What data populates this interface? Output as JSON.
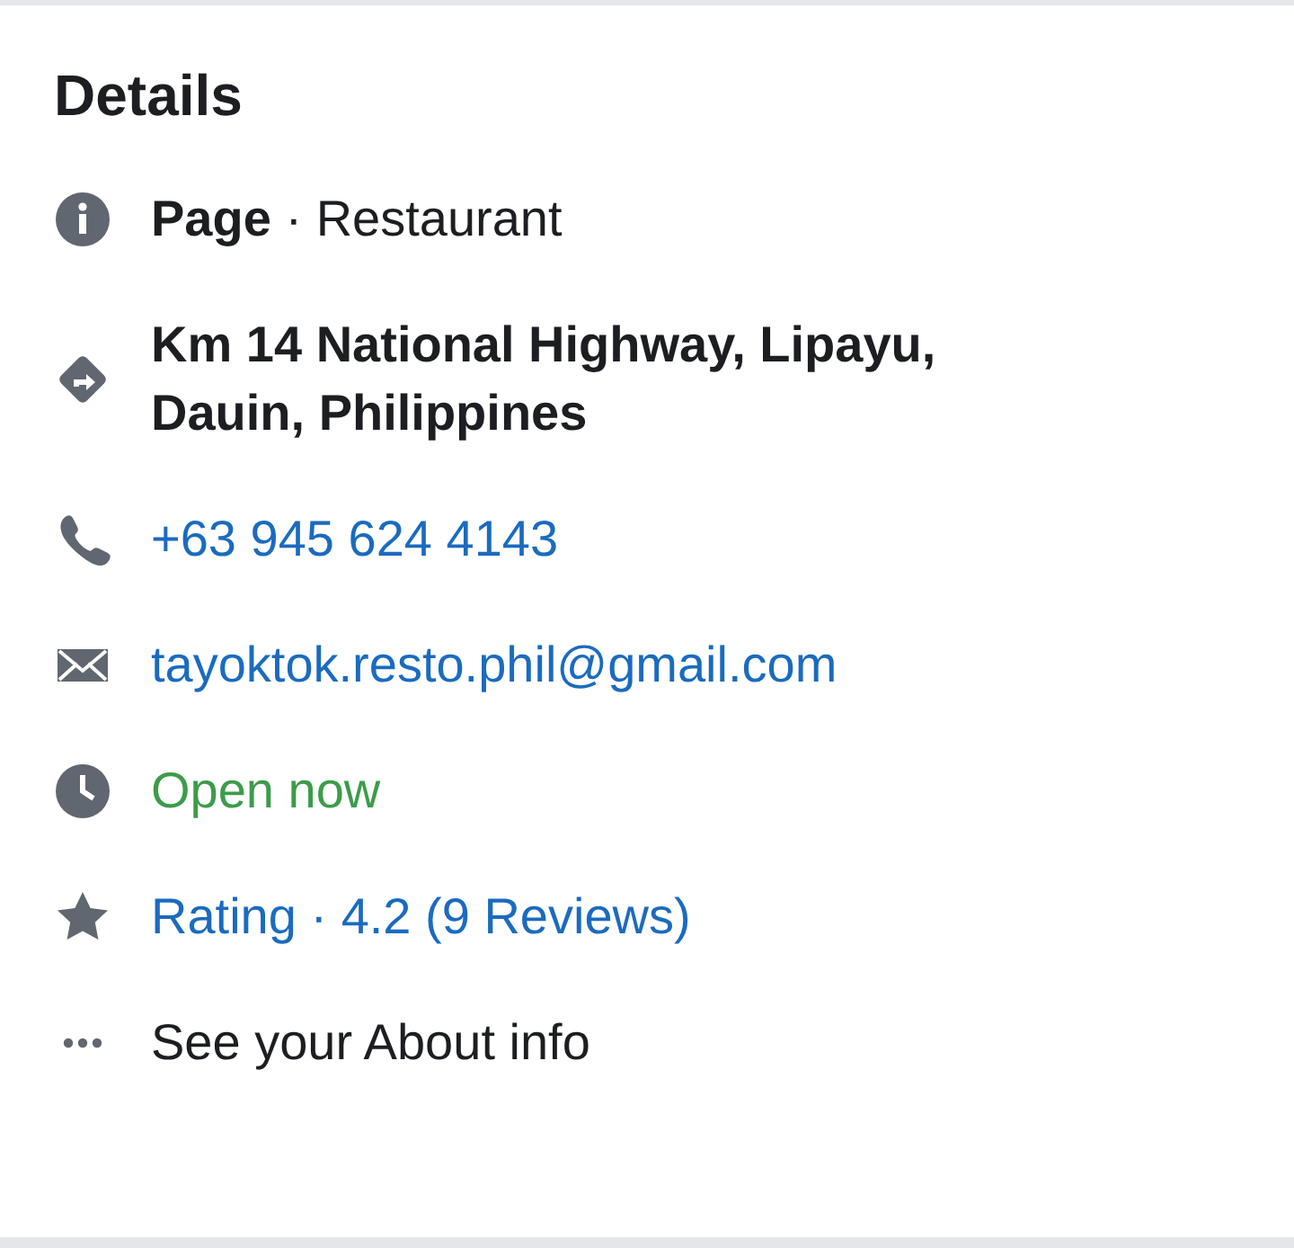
{
  "title": "Details",
  "items": [
    {
      "kind": "category",
      "text": "**Page** · Restaurant"
    },
    {
      "kind": "address",
      "text": "**Km 14 National Highway, Lipayu, Dauin, Philippines**"
    },
    {
      "kind": "phone",
      "text": "+63 945 624 4143"
    },
    {
      "kind": "email",
      "text": "tayoktok.resto.phil@gmail.com"
    },
    {
      "kind": "hours",
      "text": "Open now"
    },
    {
      "kind": "rating",
      "text": "Rating · 4.2 (9 Reviews)"
    },
    {
      "kind": "more",
      "text": "See your About info"
    }
  ]
}
